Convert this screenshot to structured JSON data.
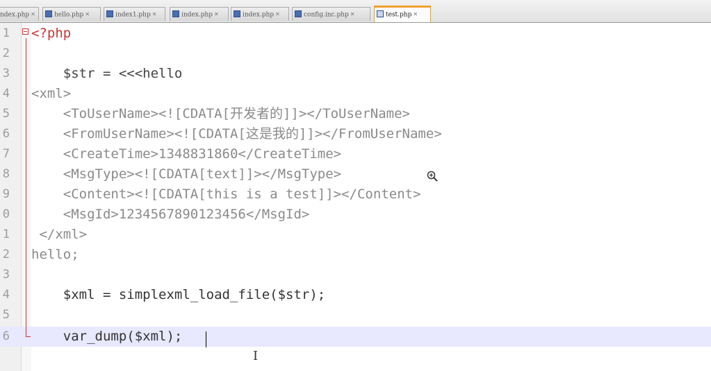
{
  "tabs": [
    {
      "label": "ndex.php"
    },
    {
      "label": "hello.php"
    },
    {
      "label": "index1.php"
    },
    {
      "label": "index.php"
    },
    {
      "label": "index.php"
    },
    {
      "label": "config.inc.php"
    },
    {
      "label": "test.php"
    }
  ],
  "lines": [
    {
      "num": "1",
      "text": "<?php"
    },
    {
      "num": "2",
      "text": ""
    },
    {
      "num": "3",
      "text": "    $str = <<<hello"
    },
    {
      "num": "4",
      "text": "<xml>"
    },
    {
      "num": "5",
      "text": "    <ToUserName><![CDATA[开发者的]]></ToUserName>"
    },
    {
      "num": "6",
      "text": "    <FromUserName><![CDATA[这是我的]]></FromUserName>"
    },
    {
      "num": "7",
      "text": "    <CreateTime>1348831860</CreateTime>"
    },
    {
      "num": "8",
      "text": "    <MsgType><![CDATA[text]]></MsgType>"
    },
    {
      "num": "9",
      "text": "    <Content><![CDATA[this is a test]]></Content>"
    },
    {
      "num": "0",
      "text": "    <MsgId>1234567890123456</MsgId>"
    },
    {
      "num": "1",
      "text": " </xml>"
    },
    {
      "num": "2",
      "text": "hello;"
    },
    {
      "num": "3",
      "text": ""
    },
    {
      "num": "4",
      "text": "    $xml = simplexml_load_file($str);"
    },
    {
      "num": "5",
      "text": ""
    },
    {
      "num": "6",
      "text": "    var_dump($xml);"
    }
  ]
}
